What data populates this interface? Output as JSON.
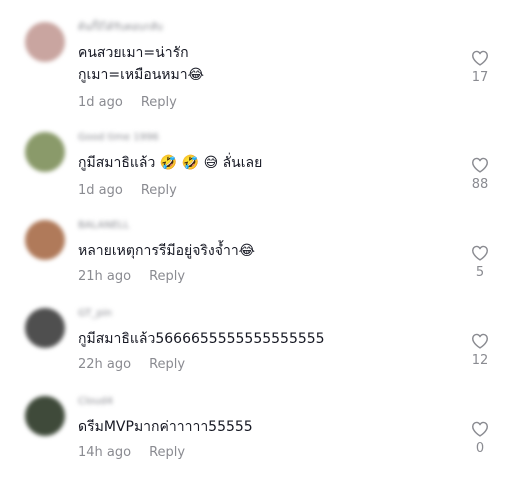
{
  "comments": [
    {
      "username": "ต้นกิ้งิได้รับตอบกลับ",
      "text": "คนสวยเมา=น่ารัก\nกูเมา=เหมือนหมา😂",
      "time": "1d ago",
      "reply_label": "Reply",
      "likes": "17",
      "avatar_color": "#c9a5a0"
    },
    {
      "username": "Good time 1996",
      "text": "กูมีสมาธิแล้ว 🤣 🤣 😅 ลั่นเลย",
      "time": "1d ago",
      "reply_label": "Reply",
      "likes": "88",
      "avatar_color": "#8a9a6a"
    },
    {
      "username": "BALANELL",
      "text": "หลายเหตุการรีมีอยู่จริงจ้ำา😂",
      "time": "21h ago",
      "reply_label": "Reply",
      "likes": "5",
      "avatar_color": "#b07a5a"
    },
    {
      "username": "GT_pin",
      "text": "กูมีสมาธิแล้ว5666655555555555555",
      "time": "22h ago",
      "reply_label": "Reply",
      "likes": "12",
      "avatar_color": "#4f4f4f"
    },
    {
      "username": "Cloud4",
      "text": "ดรีมMVPมากค่าาาาา55555",
      "time": "14h ago",
      "reply_label": "Reply",
      "likes": "0",
      "avatar_color": "#3f4a3a"
    }
  ]
}
